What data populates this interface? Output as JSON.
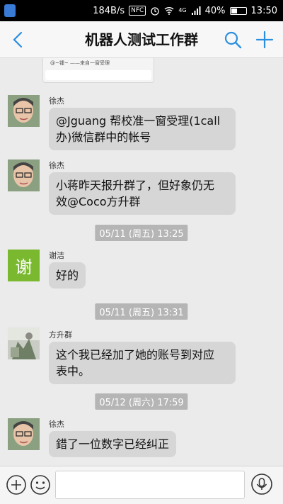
{
  "status_bar": {
    "speed": "184B/s",
    "nfc": "NFC",
    "network": "4G",
    "battery": "40%",
    "battery_level": 0.4,
    "time": "13:50"
  },
  "header": {
    "title": "机器人测试工作群"
  },
  "clip_preview": {
    "text": "@~锺~ ——来自一窗受理"
  },
  "messages": [
    {
      "sender": "徐杰",
      "text_lines": [
        "@Jguang 帮校准一窗受理(1call",
        "办)微信群中的帐号"
      ]
    },
    {
      "sender": "徐杰",
      "text_lines": [
        "小蒋昨天报升群了，但好象仍无",
        "效@Coco方升群"
      ]
    },
    {
      "timestamp": "05/11 (周五) 13:25"
    },
    {
      "sender": "谢洁",
      "avatar_char": "谢",
      "text_lines": [
        "好的"
      ]
    },
    {
      "timestamp": "05/11 (周五) 13:31"
    },
    {
      "sender": "方升群",
      "text_lines": [
        "这个我已经加了她的账号到对应",
        "表中。"
      ]
    },
    {
      "timestamp": "05/12 (周六) 17:59"
    },
    {
      "sender": "徐杰",
      "text_lines": [
        "錯了一位数字已经纠正"
      ]
    }
  ],
  "colors": {
    "accent": "#2b8fe0",
    "bubble": "#d6d6d6",
    "background": "#ebebeb",
    "timestamp_bg": "#b5b5b5",
    "avatar_green": "#7ab830"
  },
  "icons": {
    "back": "chevron-left-icon",
    "search": "search-icon",
    "add": "plus-icon",
    "attach": "plus-circle-icon",
    "emoji": "smiley-icon",
    "voice": "microphone-icon"
  }
}
